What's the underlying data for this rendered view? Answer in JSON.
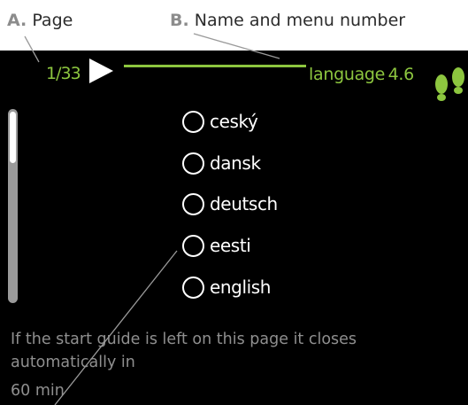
{
  "annotations": {
    "a_letter": "A.",
    "a_text": "Page",
    "b_letter": "B.",
    "b_text": "Name and menu number"
  },
  "header": {
    "page": "1/33",
    "title": "language",
    "menu_number": "4.6",
    "icon": "footsteps-icon"
  },
  "languages": [
    {
      "label": "ceský",
      "selected": false
    },
    {
      "label": "dansk",
      "selected": false
    },
    {
      "label": "deutsch",
      "selected": false
    },
    {
      "label": "eesti",
      "selected": false
    },
    {
      "label": "english",
      "selected": false
    }
  ],
  "info": {
    "text": "If the start guide is left on this page it closes automatically in",
    "time": "60 min"
  },
  "colors": {
    "accent": "#8dc63f",
    "background": "#000000",
    "text": "#ffffff",
    "muted": "#8f8f8f"
  }
}
